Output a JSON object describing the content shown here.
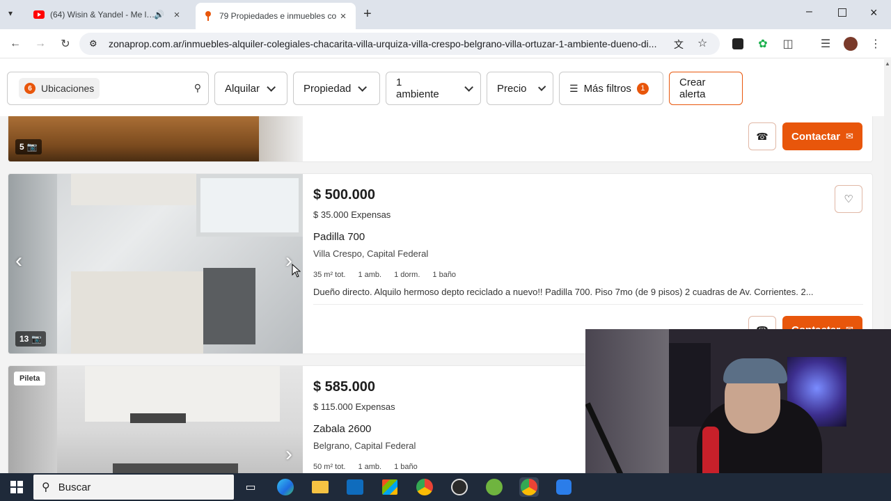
{
  "browser": {
    "tabs": [
      {
        "title": "(64) Wisin & Yandel - Me l…",
        "active": false
      },
      {
        "title": "79 Propiedades e inmuebles co…",
        "active": true
      }
    ],
    "url": "zonaprop.com.ar/inmuebles-alquiler-colegiales-chacarita-villa-urquiza-villa-crespo-belgrano-villa-ortuzar-1-ambiente-dueno-di..."
  },
  "filters": {
    "location_count": "6",
    "location_label": "Ubicaciones",
    "operation": "Alquilar",
    "property": "Propiedad",
    "rooms": "1 ambiente",
    "price": "Precio",
    "more_filters": "Más filtros",
    "more_filters_count": "1",
    "create_alert": "Crear alerta"
  },
  "listings": [
    {
      "photo_count": "5",
      "contact_label": "Contactar"
    },
    {
      "price": "$ 500.000",
      "expenses": "$ 35.000 Expensas",
      "address": "Padilla 700",
      "location": "Villa Crespo, Capital Federal",
      "features": [
        "35 m² tot.",
        "1 amb.",
        "1 dorm.",
        "1 baño"
      ],
      "description": "Dueño directo. Alquilo hermoso depto reciclado a nuevo!! Padilla 700. Piso 7mo (de 9 pisos) 2 cuadras de Av. Corrientes. 2...",
      "photo_count": "13",
      "contact_label": "Contactar"
    },
    {
      "badge": "Pileta",
      "price": "$ 585.000",
      "expenses": "$ 115.000 Expensas",
      "address": "Zabala 2600",
      "location": "Belgrano, Capital Federal",
      "features": [
        "50 m² tot.",
        "1 amb.",
        "1 baño"
      ]
    }
  ],
  "taskbar": {
    "search_placeholder": "Buscar"
  },
  "colors": {
    "accent": "#e8560b",
    "chrome_bg": "#dee3eb",
    "taskbar": "#1f2a3a"
  }
}
